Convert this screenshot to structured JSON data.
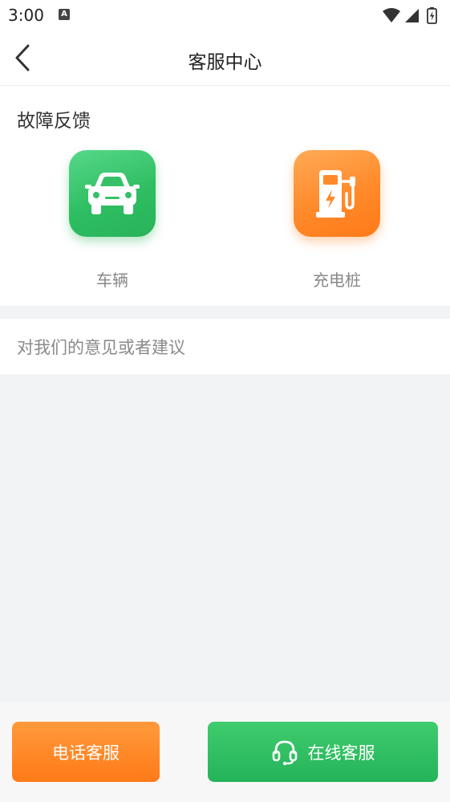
{
  "status_bar": {
    "time": "3:00",
    "notification_icon": "A",
    "icons": [
      "wifi-icon",
      "signal-icon",
      "battery-charging-icon"
    ]
  },
  "header": {
    "title": "客服中心",
    "back_icon": "chevron-left-icon"
  },
  "fault_feedback": {
    "title": "故障反馈",
    "items": [
      {
        "label": "车辆",
        "icon": "car-icon",
        "color": "#2fbe62"
      },
      {
        "label": "充电桩",
        "icon": "charging-pile-icon",
        "color": "#ff8a2a"
      }
    ]
  },
  "suggestion": {
    "label": "对我们的意见或者建议"
  },
  "bottom_actions": {
    "phone_label": "电话客服",
    "phone_color": "#ff8a2a",
    "online_label": "在线客服",
    "online_color": "#2fbe62",
    "online_icon": "headset-icon"
  }
}
